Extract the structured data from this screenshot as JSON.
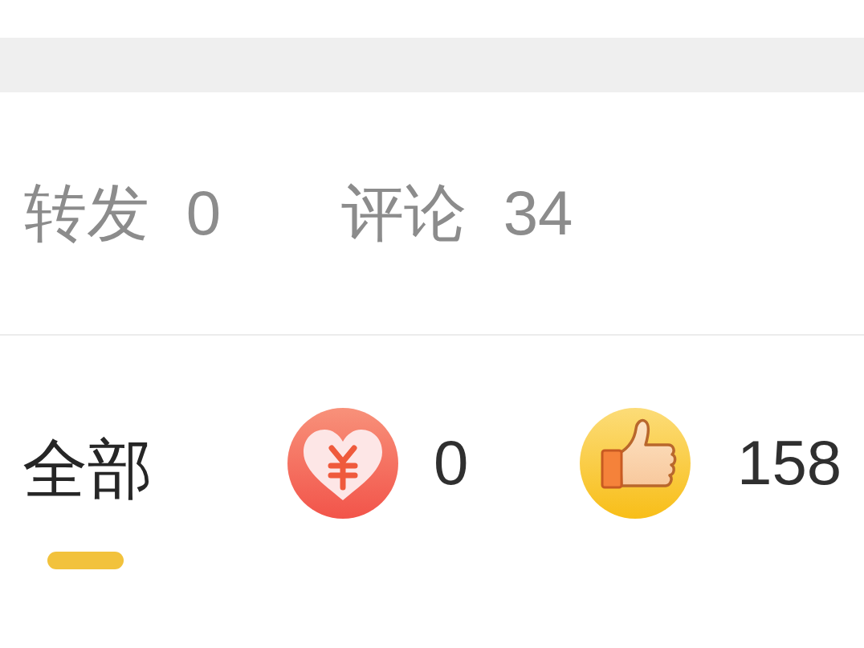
{
  "stats": [
    {
      "label": "转发",
      "count": "0"
    },
    {
      "label": "评论",
      "count": "34"
    }
  ],
  "tabs": [
    {
      "kind": "all",
      "label": "全部",
      "selected": true
    },
    {
      "kind": "reward",
      "count": "0",
      "selected": false
    },
    {
      "kind": "like",
      "count": "158",
      "selected": false
    }
  ]
}
